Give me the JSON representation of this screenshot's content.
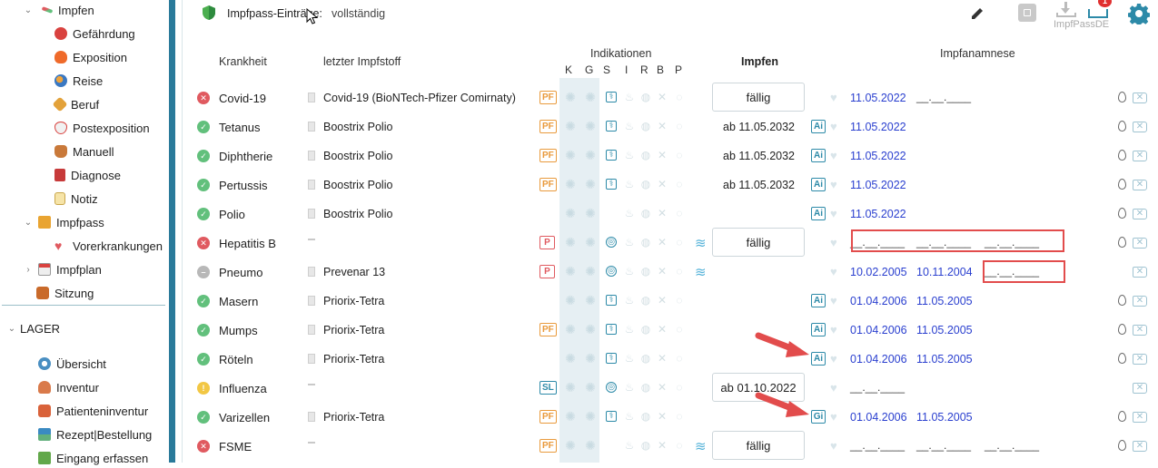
{
  "sidebar": {
    "impfen": "Impfen",
    "gefaehrdung": "Gefährdung",
    "exposition": "Exposition",
    "reise": "Reise",
    "beruf": "Beruf",
    "postexposition": "Postexposition",
    "manuell": "Manuell",
    "diagnose": "Diagnose",
    "notiz": "Notiz",
    "impfpass": "Impfpass",
    "vorerkrankungen": "Vorerkrankungen",
    "impfplan": "Impfplan",
    "sitzung": "Sitzung",
    "lager": "LAGER",
    "uebersicht": "Übersicht",
    "inventur": "Inventur",
    "patienteninventur": "Patienteninventur",
    "rezept": "Rezept|Bestellung",
    "eingang": "Eingang erfassen"
  },
  "header": {
    "entries_label": "Impfpass-Einträge:",
    "entries_value": "vollständig",
    "impfpassde": "ImpfPassDE",
    "notification_count": "1"
  },
  "columns": {
    "krankheit": "Krankheit",
    "impfstoff": "letzter Impfstoff",
    "indikationen": "Indikationen",
    "ind_letters": [
      "K",
      "G",
      "S",
      "I",
      "R",
      "B",
      "P"
    ],
    "impfen": "Impfen",
    "impfanamnese": "Impfanamnese"
  },
  "rows": [
    {
      "name": "Covid-19",
      "status": "red",
      "vaccine": "Covid-19 (BioNTech-Pfizer Comirnaty)",
      "badge": "PF",
      "impfen": "fällig",
      "impfen_button": true,
      "ai": "",
      "dates": [
        "11.05.2022",
        "__.__.____"
      ]
    },
    {
      "name": "Tetanus",
      "status": "green",
      "vaccine": "Boostrix Polio",
      "badge": "PF",
      "impfen": "ab 11.05.2032",
      "impfen_button": false,
      "ai": "Ai",
      "dates": [
        "11.05.2022"
      ]
    },
    {
      "name": "Diphtherie",
      "status": "green",
      "vaccine": "Boostrix Polio",
      "badge": "PF",
      "impfen": "ab 11.05.2032",
      "impfen_button": false,
      "ai": "Ai",
      "dates": [
        "11.05.2022"
      ]
    },
    {
      "name": "Pertussis",
      "status": "green",
      "vaccine": "Boostrix Polio",
      "badge": "PF",
      "impfen": "ab 11.05.2032",
      "impfen_button": false,
      "ai": "Ai",
      "dates": [
        "11.05.2022"
      ]
    },
    {
      "name": "Polio",
      "status": "green",
      "vaccine": "Boostrix Polio",
      "badge": "",
      "impfen": "",
      "impfen_button": false,
      "ai": "Ai",
      "dates": [
        "11.05.2022"
      ]
    },
    {
      "name": "Hepatitis B",
      "status": "red",
      "vaccine": "",
      "badge": "P",
      "impfen": "fällig",
      "impfen_button": true,
      "ai": "",
      "dates": [
        "__.__.____",
        "__.__.____",
        "__.__.____"
      ]
    },
    {
      "name": "Pneumo",
      "status": "gray",
      "vaccine": "Prevenar 13",
      "badge": "P",
      "impfen": "",
      "impfen_button": false,
      "ai": "",
      "dates": [
        "10.02.2005",
        "10.11.2004",
        "__.__.____"
      ]
    },
    {
      "name": "Masern",
      "status": "green",
      "vaccine": "Priorix-Tetra",
      "badge": "",
      "impfen": "",
      "impfen_button": false,
      "ai": "Ai",
      "dates": [
        "01.04.2006",
        "11.05.2005"
      ]
    },
    {
      "name": "Mumps",
      "status": "green",
      "vaccine": "Priorix-Tetra",
      "badge": "PF",
      "impfen": "",
      "impfen_button": false,
      "ai": "Ai",
      "dates": [
        "01.04.2006",
        "11.05.2005"
      ]
    },
    {
      "name": "Röteln",
      "status": "green",
      "vaccine": "Priorix-Tetra",
      "badge": "",
      "impfen": "",
      "impfen_button": false,
      "ai": "Ai",
      "dates": [
        "01.04.2006",
        "11.05.2005"
      ]
    },
    {
      "name": "Influenza",
      "status": "yellow",
      "vaccine": "",
      "badge": "SL",
      "impfen": "ab 01.10.2022",
      "impfen_button": true,
      "ai": "",
      "dates": [
        "__.__.____"
      ]
    },
    {
      "name": "Varizellen",
      "status": "green",
      "vaccine": "Priorix-Tetra",
      "badge": "PF",
      "impfen": "",
      "impfen_button": false,
      "ai": "Gi",
      "dates": [
        "01.04.2006",
        "11.05.2005"
      ]
    },
    {
      "name": "FSME",
      "status": "red",
      "vaccine": "",
      "badge": "PF",
      "impfen": "fällig",
      "impfen_button": true,
      "ai": "",
      "dates": [
        "__.__.____",
        "__.__.____",
        "__.__.____"
      ]
    }
  ],
  "colors": {
    "accent": "#2d8aa8",
    "danger": "#e05a60",
    "ok": "#62c07c",
    "link": "#2a3fcf",
    "annotation": "#e24c4c"
  }
}
